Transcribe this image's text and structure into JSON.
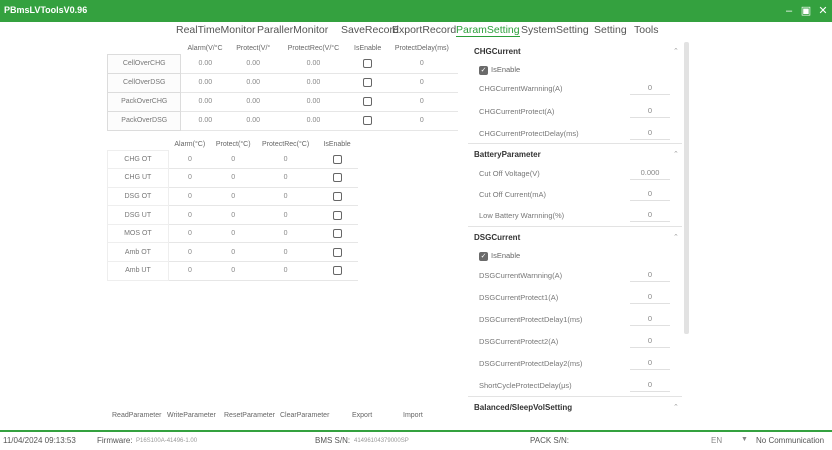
{
  "window": {
    "title": "PBmsLVToolsV0.96"
  },
  "menu": [
    "RealTimeMonitor",
    "ParallerMonitor",
    "SaveRecord",
    "ExportRecord",
    "ParamSetting",
    "SystemSetting",
    "Setting",
    "Tools"
  ],
  "active_tab": "ParamSetting",
  "table1": {
    "headers": [
      "Alarm(V/°C",
      "Protect(V/°",
      "ProtectRec(V/°C",
      "IsEnable",
      "ProtectDelay(ms)"
    ],
    "rows": [
      {
        "name": "CellOverCHG",
        "values": [
          "0.00",
          "0.00",
          "0.00"
        ],
        "delay": "0"
      },
      {
        "name": "CellOverDSG",
        "values": [
          "0.00",
          "0.00",
          "0.00"
        ],
        "delay": "0"
      },
      {
        "name": "PackOverCHG",
        "values": [
          "0.00",
          "0.00",
          "0.00"
        ],
        "delay": "0"
      },
      {
        "name": "PackOverDSG",
        "values": [
          "0.00",
          "0.00",
          "0.00"
        ],
        "delay": "0"
      }
    ]
  },
  "table2": {
    "headers": [
      "Alarm(°C)",
      "Protect(°C)",
      "ProtectRec(°C)",
      "IsEnable"
    ],
    "rows": [
      {
        "name": "CHG OT",
        "values": [
          "0",
          "0",
          "0"
        ]
      },
      {
        "name": "CHG UT",
        "values": [
          "0",
          "0",
          "0"
        ]
      },
      {
        "name": "DSG OT",
        "values": [
          "0",
          "0",
          "0"
        ]
      },
      {
        "name": "DSG UT",
        "values": [
          "0",
          "0",
          "0"
        ]
      },
      {
        "name": "MOS OT",
        "values": [
          "0",
          "0",
          "0"
        ]
      },
      {
        "name": "Amb OT",
        "values": [
          "0",
          "0",
          "0"
        ]
      },
      {
        "name": "Amb UT",
        "values": [
          "0",
          "0",
          "0"
        ]
      }
    ]
  },
  "panel": {
    "chg": {
      "title": "CHGCurrent",
      "enable_label": "IsEnable",
      "params": [
        {
          "label": "CHGCurrentWarnning(A)",
          "value": "0"
        },
        {
          "label": "CHGCurrentProtect(A)",
          "value": "0"
        },
        {
          "label": "CHGCurrentProtectDelay(ms)",
          "value": "0"
        }
      ]
    },
    "battery": {
      "title": "BatteryParameter",
      "params": [
        {
          "label": "Cut Off Voltage(V)",
          "value": "0.000"
        },
        {
          "label": "Cut Off Current(mA)",
          "value": "0"
        },
        {
          "label": "Low Battery Warnning(%)",
          "value": "0"
        }
      ]
    },
    "dsg": {
      "title": "DSGCurrent",
      "enable_label": "IsEnable",
      "params": [
        {
          "label": "DSGCurrentWarnning(A)",
          "value": "0"
        },
        {
          "label": "DSGCurrentProtect1(A)",
          "value": "0"
        },
        {
          "label": "DSGCurrentProtectDelay1(ms)",
          "value": "0"
        },
        {
          "label": "DSGCurrentProtect2(A)",
          "value": "0"
        },
        {
          "label": "DSGCurrentProtectDelay2(ms)",
          "value": "0"
        },
        {
          "label": "ShortCycleProtectDelay(μs)",
          "value": "0"
        }
      ]
    },
    "balanced": {
      "title": "Balanced/SleepVolSetting"
    }
  },
  "buttons": {
    "read": "ReadParameter",
    "write": "WriteParameter",
    "reset": "ResetParameter",
    "clear": "ClearParameter",
    "export": "Export",
    "import": "Import"
  },
  "status": {
    "datetime": "11/04/2024 09:13:53",
    "firmware_label": "Firmware:",
    "firmware_value": "P16S100A-41496-1.00",
    "bms_label": "BMS S/N:",
    "bms_value": "41496104379000SP",
    "pack_label": "PACK S/N:",
    "language": "EN",
    "connection": "No Communication"
  },
  "colors": {
    "accent": "#34a13f"
  }
}
